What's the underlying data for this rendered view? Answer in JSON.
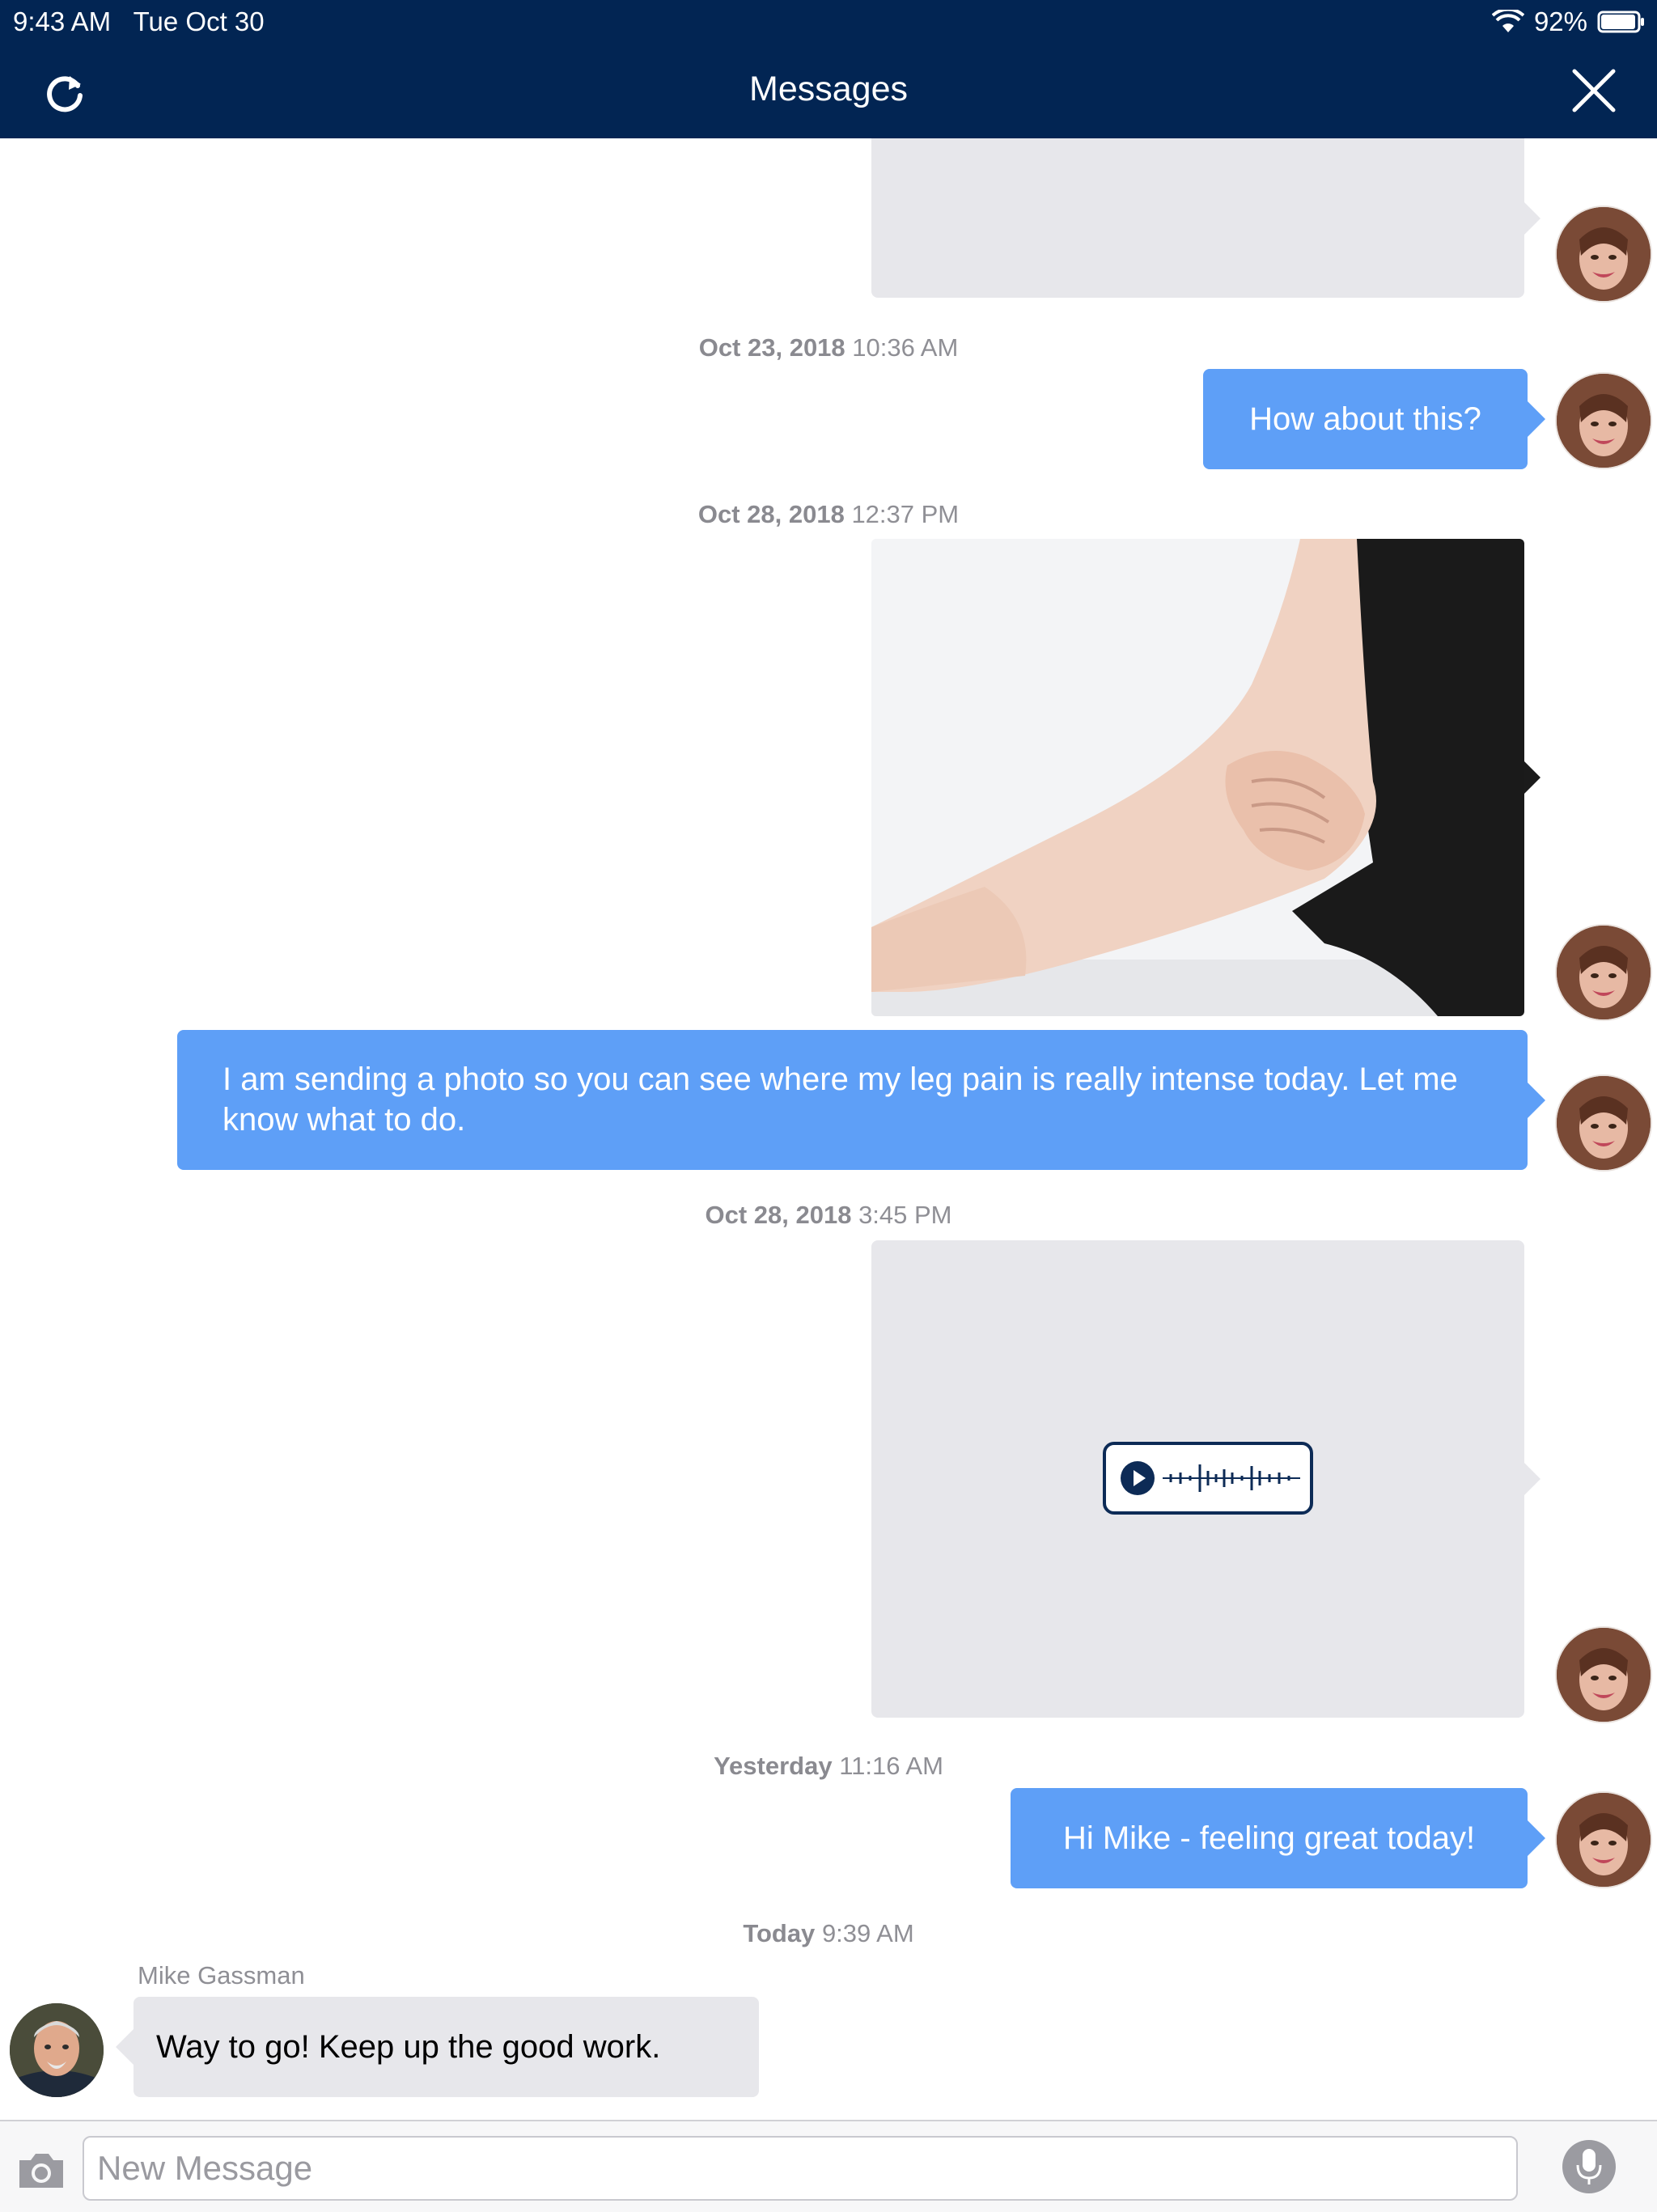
{
  "status_bar": {
    "time": "9:43 AM",
    "date": "Tue Oct 30",
    "battery": "92%"
  },
  "header": {
    "title": "Messages"
  },
  "timestamps": [
    {
      "day": "Oct 23, 2018",
      "time": "10:36 AM"
    },
    {
      "day": "Oct 28, 2018",
      "time": "12:37 PM"
    },
    {
      "day": "Oct 28, 2018",
      "time": "3:45 PM"
    },
    {
      "day": "Yesterday",
      "time": "11:16 AM"
    },
    {
      "day": "Today",
      "time": "9:39 AM"
    }
  ],
  "messages": {
    "how_about": "How about this?",
    "photo_note": "I am sending a photo so you can see where my leg pain is really intense today. Let me know what to do.",
    "feeling_great": "Hi Mike - feeling great today!",
    "reply": "Way to go!  Keep up the good work."
  },
  "incoming_sender": "Mike Gassman",
  "composer": {
    "placeholder": "New Message"
  },
  "colors": {
    "header": "#022553",
    "outgoing_bubble": "#5e9ff7",
    "incoming_bubble": "#e7e7eb"
  },
  "icons": [
    "refresh-icon",
    "close-icon",
    "wifi-icon",
    "battery-icon",
    "camera-icon",
    "microphone-icon",
    "play-icon",
    "waveform-icon"
  ]
}
